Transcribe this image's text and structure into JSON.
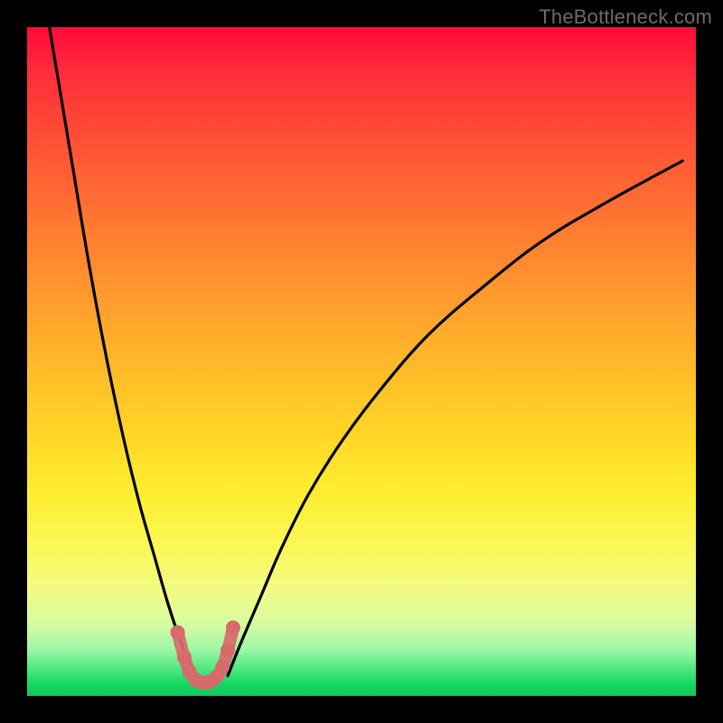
{
  "watermark": "TheBottleneck.com",
  "colors": {
    "background": "#000000",
    "curve_stroke": "#000000",
    "accent_stroke": "#d76a6c",
    "gradient_stops": [
      "#ff0a3a",
      "#ff2e3a",
      "#ff5a34",
      "#ff8a2f",
      "#ffb22a",
      "#ffd426",
      "#ffee30",
      "#fbf85a",
      "#f2fb82",
      "#d9fca0",
      "#9ff7a5",
      "#4ee87e",
      "#17d964",
      "#0fc95b"
    ]
  },
  "chart_data": {
    "type": "line",
    "title": "",
    "xlabel": "",
    "ylabel": "",
    "xlim": [
      0,
      100
    ],
    "ylim": [
      0,
      100
    ],
    "grid": false,
    "legend": false,
    "series": [
      {
        "name": "left-branch",
        "x": [
          3,
          5,
          7,
          9,
          11,
          13,
          15,
          17,
          19,
          21,
          23,
          25
        ],
        "y": [
          102,
          90,
          78,
          66,
          55,
          45,
          36,
          28,
          21,
          14,
          8,
          3
        ]
      },
      {
        "name": "right-branch",
        "x": [
          30,
          32,
          35,
          38,
          42,
          47,
          53,
          60,
          68,
          77,
          87,
          98
        ],
        "y": [
          3,
          8,
          15,
          22,
          30,
          38,
          46,
          54,
          61,
          68,
          74,
          80
        ]
      },
      {
        "name": "valley-accent",
        "x": [
          22.5,
          23.5,
          24.3,
          25.2,
          26.2,
          27.3,
          28.3,
          29.2,
          30.0,
          30.8
        ],
        "y": [
          9.5,
          5.8,
          3.6,
          2.4,
          2.0,
          2.1,
          2.8,
          4.3,
          6.8,
          10.2
        ],
        "style": "dotted"
      }
    ],
    "annotations": []
  }
}
